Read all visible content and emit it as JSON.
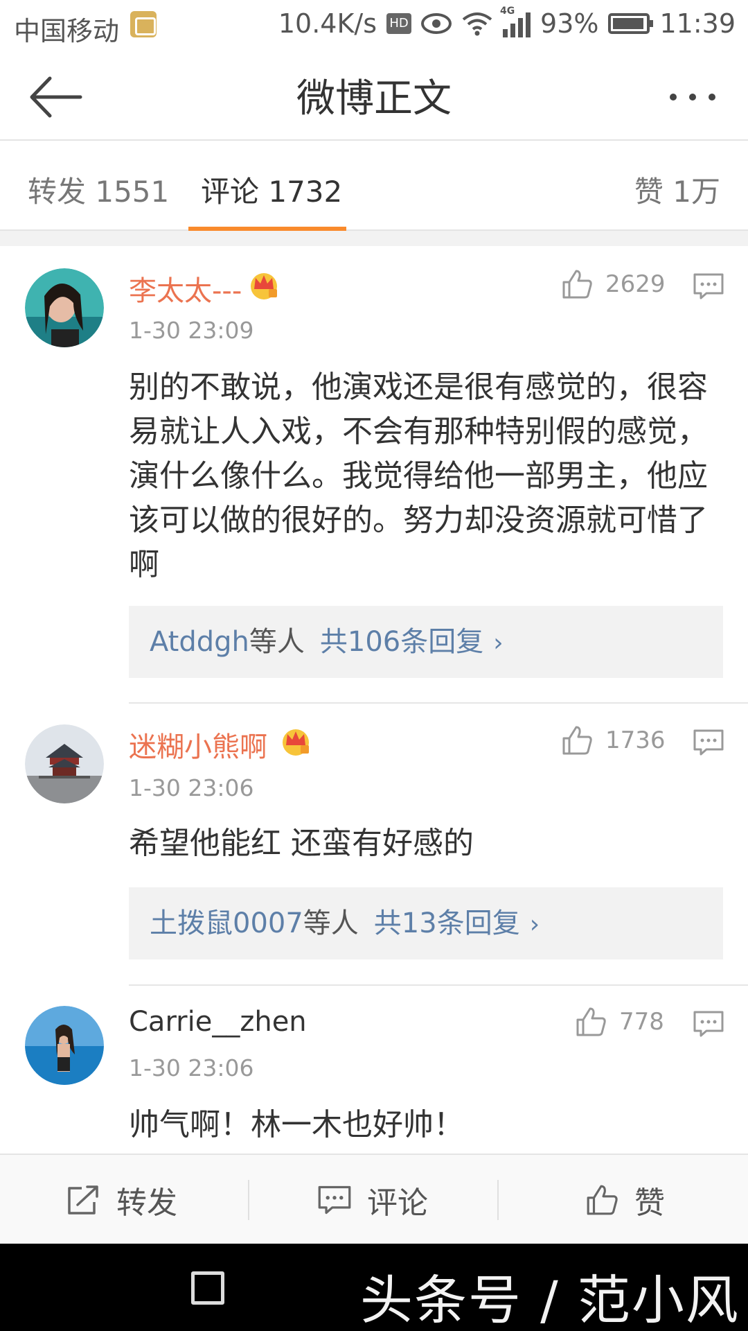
{
  "status_bar": {
    "carrier": "中国移动",
    "net_speed": "10.4K/s",
    "hd": "HD",
    "network": "4G",
    "battery": "93%",
    "time": "11:39"
  },
  "header": {
    "title": "微博正文"
  },
  "tabs": [
    {
      "label": "转发 1551"
    },
    {
      "label": "评论 1732"
    },
    {
      "label": "赞 1万"
    }
  ],
  "comments": [
    {
      "user": "李太太---",
      "time": "1-30 23:09",
      "likes": "2629",
      "text": "别的不敢说，他演戏还是很有感觉的，很容易就让人入戏，不会有那种特别假的感觉，演什么像什么。我觉得给他一部男主，他应该可以做的很好的。努力却没资源就可惜了啊",
      "reply_user": "Atddgh",
      "reply_suffix": "等人",
      "reply_count": "共106条回复",
      "chevron": "›"
    },
    {
      "user": "迷糊小熊啊",
      "time": "1-30 23:06",
      "likes": "1736",
      "text": "希望他能红 还蛮有好感的",
      "reply_user": "土拨鼠0007",
      "reply_suffix": "等人",
      "reply_count": "共13条回复",
      "chevron": "›"
    },
    {
      "user": "Carrie__zhen",
      "time": "1-30 23:06",
      "likes": "778",
      "text": "帅气啊！林一木也好帅！"
    }
  ],
  "action_bar": {
    "repost": "转发",
    "comment": "评论",
    "like": "赞"
  },
  "watermark": "头条号 / 范小风",
  "colors": {
    "accent": "#f98a2c",
    "vip_name": "#eb7350",
    "link": "#5d7fa8"
  }
}
